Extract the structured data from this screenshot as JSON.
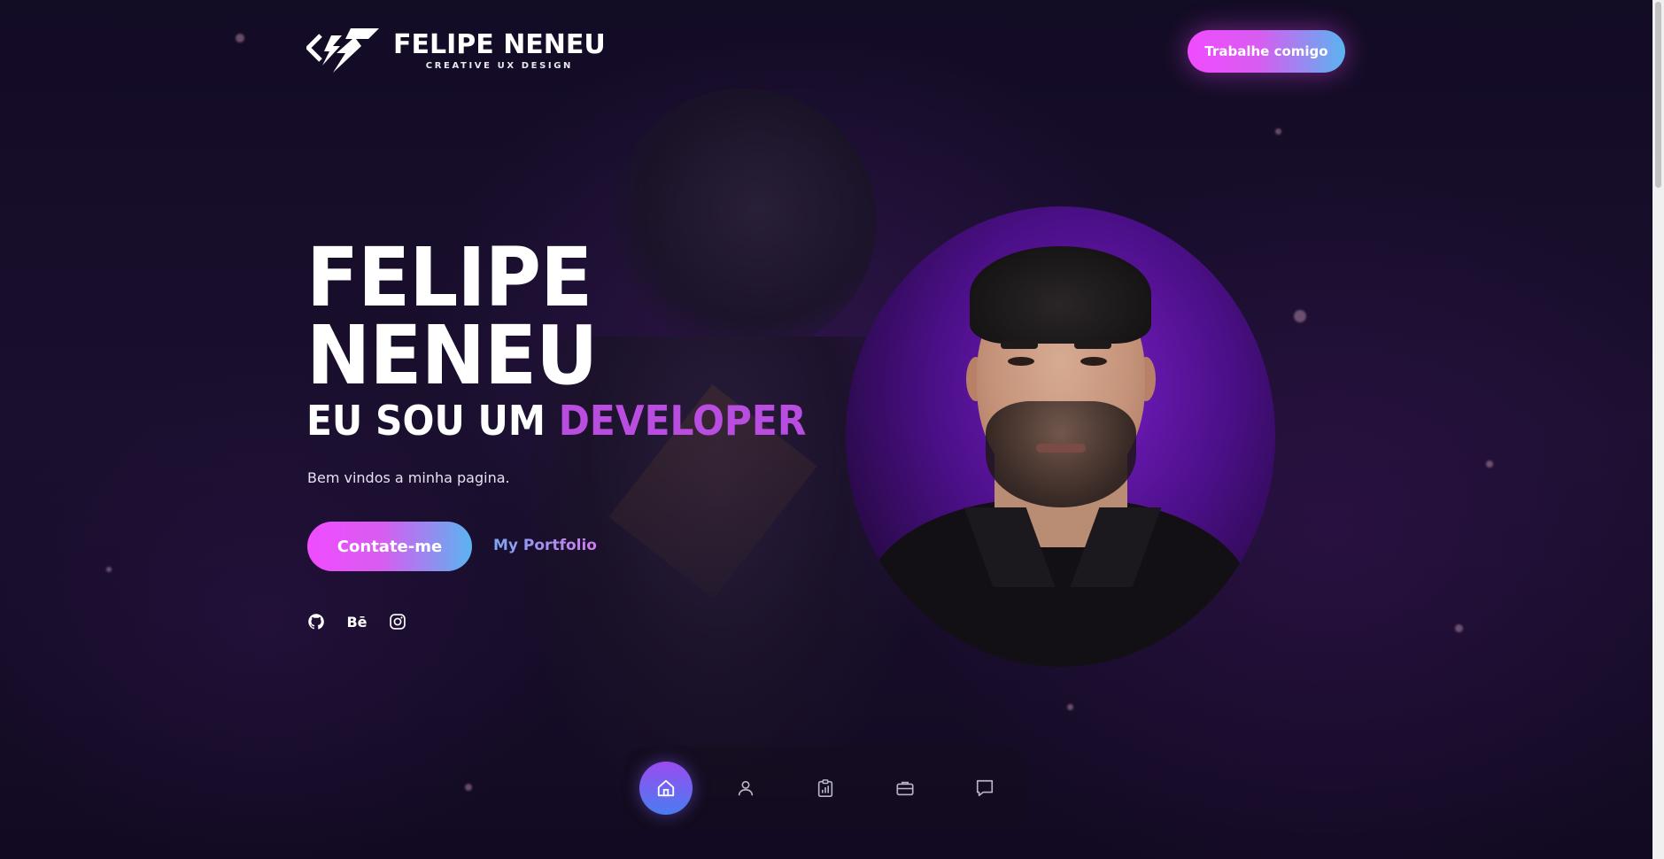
{
  "header": {
    "logo_title": "FELIPE NENEU",
    "logo_subtitle": "CREATIVE UX DESIGN",
    "cta_label": "Trabalhe comigo"
  },
  "hero": {
    "name_line1": "FELIPE",
    "name_line2": "NENEU",
    "role_prefix": "EU SOU UM",
    "role_highlight": "DEVELOPER",
    "welcome": "Bem vindos a minha pagina.",
    "contact_label": "Contate-me",
    "portfolio_label": "My Portfolio"
  },
  "socials": [
    {
      "name": "github-icon"
    },
    {
      "name": "behance-icon",
      "text": "Bē"
    },
    {
      "name": "instagram-icon"
    }
  ],
  "bottom_nav": [
    {
      "name": "home-icon",
      "active": true
    },
    {
      "name": "user-icon",
      "active": false
    },
    {
      "name": "clipboard-chart-icon",
      "active": false
    },
    {
      "name": "briefcase-icon",
      "active": false
    },
    {
      "name": "chat-icon",
      "active": false
    }
  ],
  "colors": {
    "accent_pink": "#f04cff",
    "accent_blue": "#5ab4f0",
    "highlight_purple": "#b94de0",
    "background": "#130c25"
  }
}
